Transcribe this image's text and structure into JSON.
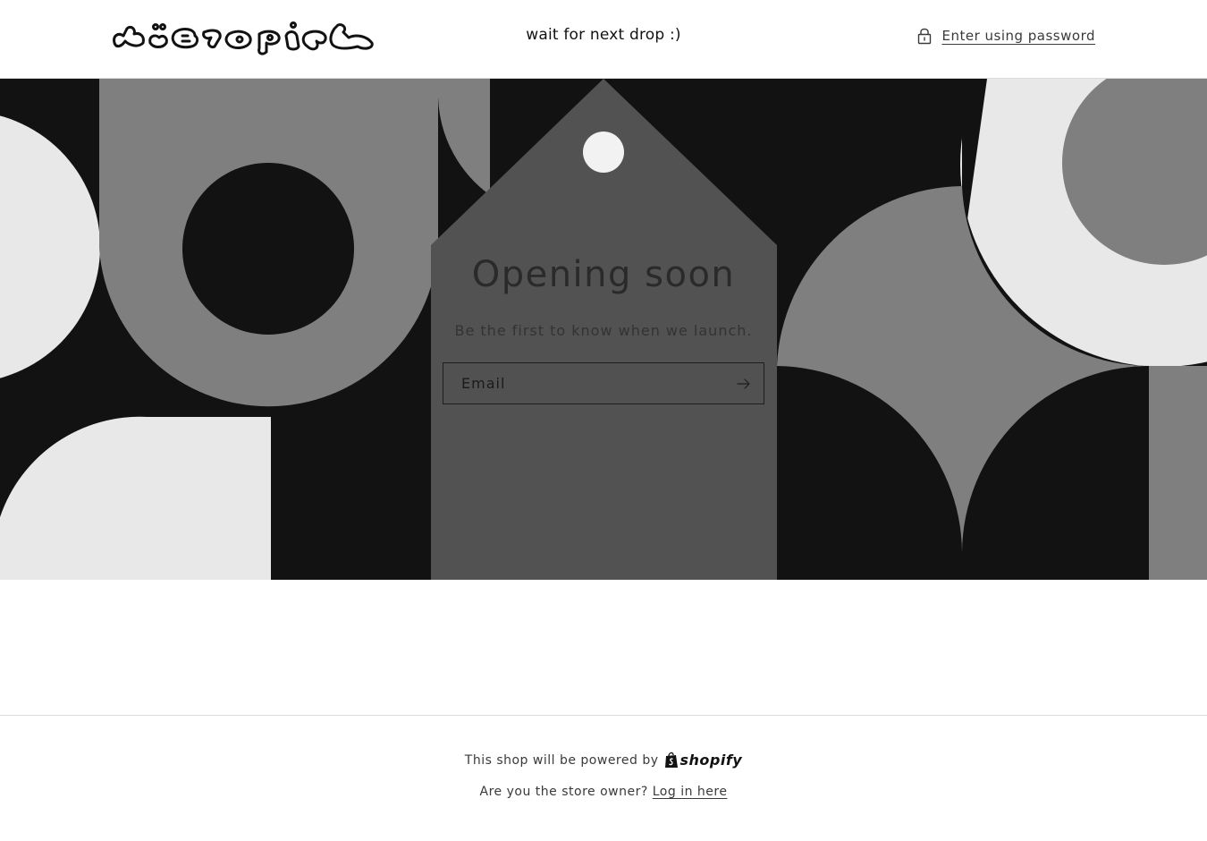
{
  "header": {
    "tagline": "wait for next drop :)",
    "password_link": "Enter using password",
    "logo_icon": "brand-logo-graffiti"
  },
  "hero": {
    "title": "Opening soon",
    "subtitle": "Be the first to know when we launch.",
    "email_placeholder": "Email",
    "submit_icon": "arrow-right-icon"
  },
  "footer": {
    "powered_text": "This shop will be powered by",
    "shopify_label": "shopify",
    "owner_question": "Are you the store owner?",
    "login_link": "Log in here"
  },
  "colors": {
    "dark": "#121212",
    "mid_gray": "#7f7f7f",
    "light_gray": "#e8e8e8",
    "tag_gray": "#525252"
  }
}
